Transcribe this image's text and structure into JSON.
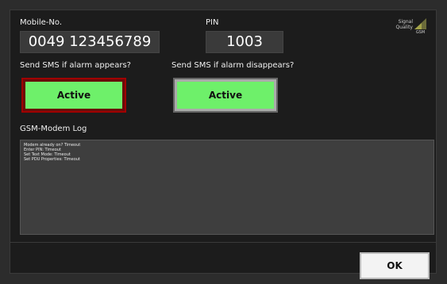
{
  "dialog": {
    "mobile_label": "Mobile-No.",
    "mobile_value": "0049 123456789",
    "pin_label": "PIN",
    "pin_value": "1003",
    "signal_label": "Signal Quality",
    "signal_bars_text": "GSM",
    "send_on_appear_label": "Send SMS if alarm appears?",
    "send_on_appear_button": "Active",
    "send_on_disappear_label": "Send SMS if alarm disappears?",
    "send_on_disappear_button": "Active",
    "log_label": "GSM-Modem Log",
    "log_lines": [
      "Modem already on? Timeout",
      "Enter PIN: Timeout",
      "Set Text Mode: Timeout",
      "Set PDU Properties: Timeout"
    ],
    "ok_button": "OK"
  },
  "colors": {
    "active_green": "#6ef06a",
    "alarm_border": "#a00000",
    "panel_bg": "#1c1c1c",
    "field_bg": "#3a3a3a"
  },
  "icons": {
    "signal": "signal-quality-icon"
  }
}
